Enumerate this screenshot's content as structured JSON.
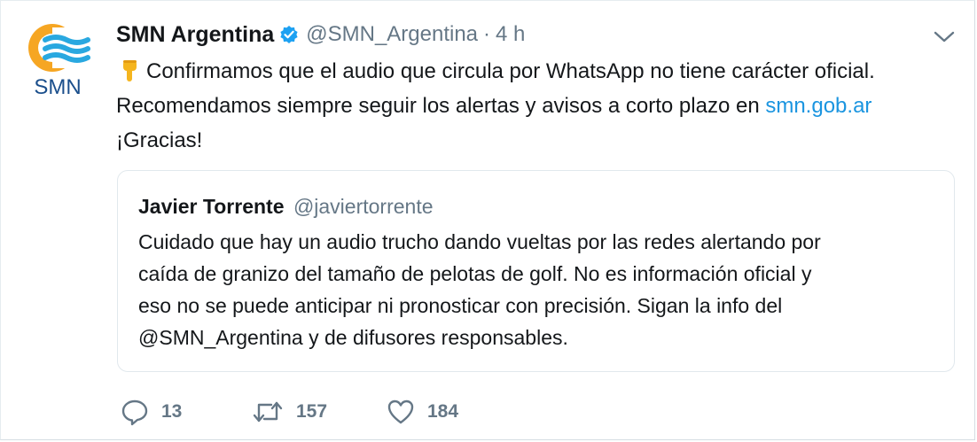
{
  "tweet": {
    "avatar": {
      "label": "SMN",
      "colors": {
        "sun": "#f6a623",
        "waves": "#29a8e0",
        "text": "#1b4f8c"
      }
    },
    "display_name": "SMN Argentina",
    "verified": true,
    "handle": "@SMN_Argentina",
    "separator": "·",
    "time": "4 h",
    "emoji": "backhand-index-pointing-down",
    "lines": [
      "Confirmamos que el audio que circula por WhatsApp no tiene carácter oficial.",
      "Recomendamos siempre seguir los alertas y avisos a corto plazo en ",
      "¡Gracias!"
    ],
    "link_text": "smn.gob.ar"
  },
  "quoted": {
    "display_name": "Javier Torrente",
    "handle": "@javiertorrente",
    "lines": [
      "Cuidado que hay un audio trucho dando vueltas por las redes alertando por",
      "caída de granizo del tamaño de pelotas de golf. No es información oficial y",
      "eso no se puede anticipar ni pronosticar con precisión. Sigan la info del",
      "@SMN_Argentina y de difusores responsables."
    ]
  },
  "actions": {
    "reply": {
      "icon": "reply-icon",
      "count": "13"
    },
    "retweet": {
      "icon": "retweet-icon",
      "count": "157"
    },
    "like": {
      "icon": "heart-icon",
      "count": "184"
    }
  },
  "colors": {
    "text": "#14171a",
    "muted": "#657786",
    "link": "#1b95e0",
    "verified": "#1da1f2",
    "border": "#e1e8ed"
  }
}
